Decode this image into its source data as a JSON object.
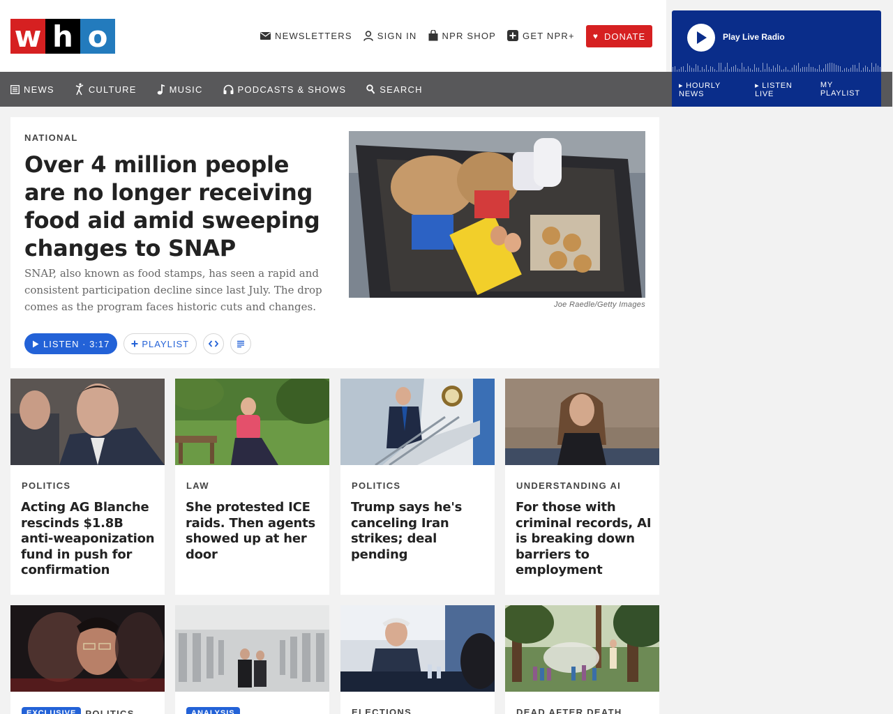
{
  "header": {
    "logo": [
      "w",
      "h",
      "o"
    ],
    "topnav": [
      {
        "label": "NEWSLETTERS",
        "icon": "envelope-icon"
      },
      {
        "label": "SIGN IN",
        "icon": "user-icon"
      },
      {
        "label": "NPR SHOP",
        "icon": "shopping-bag-icon"
      },
      {
        "label": "GET NPR+",
        "icon": "plus-square-icon"
      }
    ],
    "donate": "DONATE"
  },
  "navbar": [
    {
      "label": "NEWS",
      "icon": "newspaper-icon"
    },
    {
      "label": "CULTURE",
      "icon": "dancer-icon"
    },
    {
      "label": "MUSIC",
      "icon": "music-note-icon"
    },
    {
      "label": "PODCASTS & SHOWS",
      "icon": "headphones-icon"
    },
    {
      "label": "SEARCH",
      "icon": "search-icon"
    }
  ],
  "radio": {
    "play_label": "Play Live Radio",
    "links": [
      "▸ HOURLY NEWS",
      "▸ LISTEN LIVE",
      "MY PLAYLIST"
    ]
  },
  "lead": {
    "slug": "NATIONAL",
    "headline": "Over 4 million people are no longer receiving food aid amid sweeping changes to SNAP",
    "teaser": "SNAP, also known as food stamps, has seen a rapid and consistent participation decline since last July. The drop comes as the program faces historic cuts and changes.",
    "credit": "Joe Raedle/Getty Images",
    "listen": "LISTEN · 3:17",
    "playlist": "PLAYLIST"
  },
  "cards": [
    {
      "slug": "POLITICS",
      "headline": "Acting AG Blanche rescinds $1.8B anti-weaponization fund in push for confirmation"
    },
    {
      "slug": "LAW",
      "headline": "She protested ICE raids. Then agents showed up at her door"
    },
    {
      "slug": "POLITICS",
      "headline": "Trump says he's canceling Iran strikes; deal pending"
    },
    {
      "slug": "UNDERSTANDING AI",
      "headline": "For those with criminal records, AI is breaking down barriers to employment"
    }
  ],
  "cards2": [
    {
      "tag": "EXCLUSIVE",
      "slug": "POLITICS"
    },
    {
      "tag": "ANALYSIS",
      "slug": ""
    },
    {
      "tag": "",
      "slug": "ELECTIONS"
    },
    {
      "tag": "",
      "slug": "DEAD AFTER DEATH"
    }
  ],
  "colors": {
    "accent": "#2362d7",
    "donate": "#d62021",
    "nav": "#58585a",
    "radio": "#0a2d8a"
  }
}
